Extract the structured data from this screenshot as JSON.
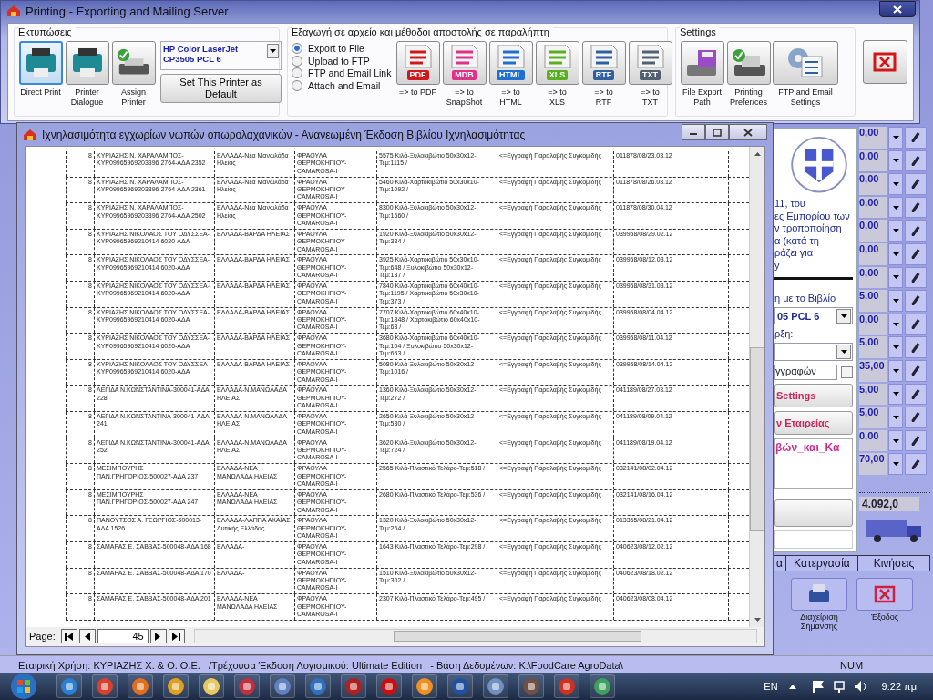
{
  "print_window": {
    "title": "Printing - Exporting and Mailing Server",
    "printers": {
      "label": "Εκτυπώσεις",
      "buttons": [
        {
          "kind": "direct",
          "label": "Direct Print",
          "selected": true
        },
        {
          "kind": "dialogue",
          "label": "Printer Dialogue",
          "selected": false
        },
        {
          "kind": "assign",
          "label": "Assign Printer",
          "selected": false
        }
      ],
      "printer_select": {
        "value": "HP Color LaserJet CP3505 PCL 6"
      },
      "default_button": "Set This Printer as Default"
    },
    "export": {
      "label": "Εξαγωγή σε αρχείο και μέθοδοι αποστολής σε παραλήπτη",
      "methods": [
        {
          "label": "Export to File",
          "selected": true
        },
        {
          "label": "Upload to FTP",
          "selected": false
        },
        {
          "label": "FTP and Email Link",
          "selected": false
        },
        {
          "label": "Attach and Email",
          "selected": false
        }
      ],
      "formats": [
        {
          "kind": "pdf",
          "badge": "PDF",
          "label": "=> to PDF"
        },
        {
          "kind": "mdb",
          "badge": "MDB",
          "label": "=> to\nSnapShot"
        },
        {
          "kind": "html",
          "badge": "HTML",
          "label": "=> to\nHTML"
        },
        {
          "kind": "xls",
          "badge": "XLS",
          "label": "=> to\nXLS"
        },
        {
          "kind": "rtf",
          "badge": "RTF",
          "label": "=> to\nRTF"
        },
        {
          "kind": "txt",
          "badge": "TXT",
          "label": "=> to\nTXT"
        }
      ]
    },
    "settings": {
      "label": "Settings",
      "buttons": [
        {
          "kind": "path",
          "label": "File Export\nPath"
        },
        {
          "kind": "prefs",
          "label": "Printing\nPrefer/ces"
        },
        {
          "kind": "ftp",
          "label": "FTP and Email\nSettings"
        }
      ]
    }
  },
  "report_window": {
    "title": "Ιχνηλασιμότητα εγχωρίων νωπών οπωρολαχανικών - Ανανεωμένη Έκδοση Βιβλίου Ιχνηλασιμότητας",
    "rows": [
      {
        "cells": [
          "8",
          "ΚΥΡΙΑΖΗΣ Ν. ΧΑΡΑΛΑΜΠΟΣ-ΚΥΡ09965969203396 2764-ΑΔΑ 2352",
          "ΕΛΛΑΔΑ-Νέα Μανωλάδα Ηλείας",
          "ΦΡΑΟΥΛΑ ΘΕΡΜΟΚΗΠΙΟΥ-CAMAROSA-I",
          "5575 Κιλά-Ξυλοκιβώτιο 50x30x12-Τεμ:1115 /",
          "<=Εγγραφή Παραλαβής Συγκομιδής",
          "011878/08/23.03.12"
        ]
      },
      {
        "cells": [
          "8",
          "ΚΥΡΙΑΖΗΣ Ν. ΧΑΡΑΛΑΜΠΟΣ-ΚΥΡ09965969203396 2764-ΑΔΑ 2361",
          "ΕΛΛΑΔΑ-Νέα Μανωλάδα Ηλείας",
          "ΦΡΑΟΥΛΑ ΘΕΡΜΟΚΗΠΙΟΥ-CAMAROSA-I",
          "5460 Κιλά-Χαρτοκιβώτιο 50x30x10-Τεμ:1092 /",
          "<=Εγγραφή Παραλαβής Συγκομιδής",
          "011878/08/26.03.12"
        ]
      },
      {
        "cells": [
          "8",
          "ΚΥΡΙΑΖΗΣ Ν. ΧΑΡΑΛΑΜΠΟΣ-ΚΥΡ09965969203396 2764-ΑΔΑ 2502",
          "ΕΛΛΑΔΑ-Νέα Μανωλάδα Ηλείας",
          "ΦΡΑΟΥΛΑ ΘΕΡΜΟΚΗΠΙΟΥ-CAMAROSA-I",
          "8300 Κιλά-Ξυλοκιβώτιο 50x30x12-Τεμ:1660 /",
          "<=Εγγραφή Παραλαβής Συγκομιδής",
          "011878/08/30.04.12"
        ]
      },
      {
        "cells": [
          "8",
          "ΚΥΡΙΑΖΗΣ ΝΙΚΟΛΑΟΣ ΤΟΥ ΟΔΥΣΣΕΑ-ΚΥΡ09965969210414 6020-ΑΔΑ",
          "ΕΛΛΑΔΑ-ΒΑΡΔΑ ΗΛΕΙΑΣ",
          "ΦΡΑΟΥΛΑ ΘΕΡΜΟΚΗΠΙΟΥ-CAMAROSA-I",
          "1920 Κιλά-Ξυλοκιβώτιο 50x30x12-Τεμ:384 /",
          "<=Εγγραφή Παραλαβής Συγκομιδής",
          "039958/08/29.02.12"
        ]
      },
      {
        "cells": [
          "8",
          "ΚΥΡΙΑΖΗΣ ΝΙΚΟΛΑΟΣ ΤΟΥ ΟΔΥΣΣΕΑ-ΚΥΡ09965969210414 6020-ΑΔΑ",
          "ΕΛΛΑΔΑ-ΒΑΡΔΑ ΗΛΕΙΑΣ",
          "ΦΡΑΟΥΛΑ ΘΕΡΜΟΚΗΠΙΟΥ-CAMAROSA-I",
          "3925 Κιλά-Χαρτοκιβώτιο 50x30x10-Τεμ:648 / Ξυλοκιβώτιο 50x30x12-Τεμ:137 /",
          "<=Εγγραφή Παραλαβής Συγκομιδής",
          "039958/08/12.03.12"
        ]
      },
      {
        "cells": [
          "8",
          "ΚΥΡΙΑΖΗΣ ΝΙΚΟΛΑΟΣ ΤΟΥ ΟΔΥΣΣΕΑ-ΚΥΡ09965969210414 6020-ΑΔΑ",
          "ΕΛΛΑΔΑ-ΒΑΡΔΑ ΗΛΕΙΑΣ",
          "ΦΡΑΟΥΛΑ ΘΕΡΜΟΚΗΠΙΟΥ-CAMAROSA-I",
          "7840 Κιλά-Χαρτοκιβώτιο 60x40x10-Τεμ:1195 / Χαρτοκιβώτιο 50x30x10-Τεμ:373 /",
          "<=Εγγραφή Παραλαβής Συγκομιδής",
          "039958/08/31.03.12"
        ]
      },
      {
        "cells": [
          "8",
          "ΚΥΡΙΑΖΗΣ ΝΙΚΟΛΑΟΣ ΤΟΥ ΟΔΥΣΣΕΑ-ΚΥΡ09965969210414 6020-ΑΔΑ",
          "ΕΛΛΑΔΑ-ΒΑΡΔΑ ΗΛΕΙΑΣ",
          "ΦΡΑΟΥΛΑ ΘΕΡΜΟΚΗΠΙΟΥ-CAMAROSA-I",
          "7707 Κιλά-Χαρτοκιβώτιο 60x40x10-Τεμ:1848 / Χαρτοκιβώτιο 60x40x10-Τεμ:63 /",
          "<=Εγγραφή Παραλαβής Συγκομιδής",
          "039958/08/04.04.12"
        ]
      },
      {
        "cells": [
          "8",
          "ΚΥΡΙΑΖΗΣ ΝΙΚΟΛΑΟΣ ΤΟΥ ΟΔΥΣΣΕΑ-ΚΥΡ09965969210414 6020-ΑΔΑ",
          "ΕΛΛΑΔΑ-ΒΑΡΔΑ ΗΛΕΙΑΣ",
          "ΦΡΑΟΥΛΑ ΘΕΡΜΟΚΗΠΙΟΥ-CAMAROSA-I",
          "3680 Κιλά-Χαρτοκιβώτιο 60x40x10-Τεμ:104 / Ξυλοκιβώτιο 50x30x12-Τεμ:653 /",
          "<=Εγγραφή Παραλαβής Συγκομιδής",
          "039958/08/11.04.12"
        ]
      },
      {
        "cells": [
          "8",
          "ΚΥΡΙΑΖΗΣ ΝΙΚΟΛΑΟΣ ΤΟΥ ΟΔΥΣΣΕΑ-ΚΥΡ09965969210414 6020-ΑΔΑ",
          "ΕΛΛΑΔΑ-ΒΑΡΔΑ ΗΛΕΙΑΣ",
          "ΦΡΑΟΥΛΑ ΘΕΡΜΟΚΗΠΙΟΥ-CAMAROSA-I",
          "5080 Κιλά-Ξυλοκιβώτιο 50x30x12-Τεμ:1016 /",
          "<=Εγγραφή Παραλαβής Συγκομιδής",
          "039958/08/14.04.12"
        ]
      },
      {
        "cells": [
          "8",
          "ΛΕΓΙΔΑ Ν.ΚΩΝΣΤΑΝΤΙΝΑ-300041-ΑΔΑ 228",
          "ΕΛΛΑΔΑ-Ν.ΜΑΝΩΛΑΔΑ ΗΛΕΙΑΣ",
          "ΦΡΑΟΥΛΑ ΘΕΡΜΟΚΗΠΙΟΥ-CAMAROSA-I",
          "1360 Κιλά-Ξυλοκιβώτιο 50x30x12-Τεμ:272 /",
          "<=Εγγραφή Παραλαβής Συγκομιδής",
          "041189/08/27.03.12"
        ]
      },
      {
        "cells": [
          "8",
          "ΛΕΓΙΔΑ Ν.ΚΩΝΣΤΑΝΤΙΝΑ-300041-ΑΔΑ 241",
          "ΕΛΛΑΔΑ-Ν.ΜΑΝΩΛΑΔΑ ΗΛΕΙΑΣ",
          "ΦΡΑΟΥΛΑ ΘΕΡΜΟΚΗΠΙΟΥ-CAMAROSA-I",
          "2650 Κιλά-Ξυλοκιβώτιο 50x30x12-Τεμ:530 /",
          "<=Εγγραφή Παραλαβής Συγκομιδής",
          "041189/08/09.04.12"
        ]
      },
      {
        "cells": [
          "8",
          "ΛΕΓΙΔΑ Ν.ΚΩΝΣΤΑΝΤΙΝΑ-300041-ΑΔΑ 252",
          "ΕΛΛΑΔΑ-Ν.ΜΑΝΩΛΑΔΑ ΗΛΕΙΑΣ",
          "ΦΡΑΟΥΛΑ ΘΕΡΜΟΚΗΠΙΟΥ-CAMAROSA-I",
          "3620 Κιλά-Ξυλοκιβώτιο 50x30x12-Τεμ:724 /",
          "<=Εγγραφή Παραλαβής Συγκομιδής",
          "041189/08/19.04.12"
        ]
      },
      {
        "cells": [
          "8",
          "ΜΕΣΙΜΠΟΥΡΗΣ ΠΑΝ.ΓΡΗΓΟΡΙΟΣ-500027-ΑΔΑ 237",
          "ΕΛΛΑΔΑ-ΝΕΑ ΜΑΝΩΛΑΔΑ ΗΛΕΙΑΣ",
          "ΦΡΑΟΥΛΑ ΘΕΡΜΟΚΗΠΙΟΥ-CAMAROSA-I",
          "2565 Κιλά-Πλαστικό Τελάρο-Τεμ:518 /",
          "<=Εγγραφή Παραλαβής Συγκομιδής",
          "032141/08/02.04.12"
        ]
      },
      {
        "cells": [
          "8",
          "ΜΕΣΙΜΠΟΥΡΗΣ ΠΑΝ.ΓΡΗΓΟΡΙΟΣ-500027-ΑΔΑ 247",
          "ΕΛΛΑΔΑ-ΝΕΑ ΜΑΝΩΛΑΔΑ ΗΛΕΙΑΣ",
          "ΦΡΑΟΥΛΑ ΘΕΡΜΟΚΗΠΙΟΥ-CAMAROSA-I",
          "2680 Κιλά-Πλαστικό Τελάρο-Τεμ:536 /",
          "<=Εγγραφή Παραλαβής Συγκομιδής",
          "032141/08/16.04.12"
        ]
      },
      {
        "cells": [
          "8",
          "ΠΑΝΟΥΤΣΟΣ Α. ΓΕΩΡΓΙΟΣ-500013-ΑΔΑ 1526",
          "ΕΛΛΑΔΑ-ΛΑΠΠΑ ΑΧΑΪΑΣ Δυτικής Ελλάδας",
          "ΦΡΑΟΥΛΑ ΘΕΡΜΟΚΗΠΙΟΥ-CAMAROSA-I",
          "1320 Κιλά-Ξυλοκιβώτιο 50x30x12-Τεμ:264 /",
          "<=Εγγραφή Παραλαβής Συγκομιδής",
          "013355/08/21.04.12"
        ]
      },
      {
        "cells": [
          "8",
          "ΣΑΜΑΡΑΣ Ε. ΣΑΒΒΑΣ-500048-ΑΔΑ 168",
          "ΕΛΛΑΔΑ-",
          "ΦΡΑΟΥΛΑ ΘΕΡΜΟΚΗΠΙΟΥ-CAMAROSA-I",
          "1643 Κιλά-Πλαστικό Τελάρο-Τεμ:298 /",
          "<=Εγγραφή Παραλαβής Συγκομιδής",
          "040623/08/12.02.12"
        ]
      },
      {
        "cells": [
          "8",
          "ΣΑΜΑΡΑΣ Ε. ΣΑΒΒΑΣ-500048-ΑΔΑ 170",
          "ΕΛΛΑΔΑ-",
          "ΦΡΑΟΥΛΑ ΘΕΡΜΟΚΗΠΙΟΥ-CAMAROSA-I",
          "1510 Κιλά-Ξυλοκιβώτιο 50x30x12-Τεμ:302 /",
          "<=Εγγραφή Παραλαβής Συγκομιδής",
          "040623/08/18.02.12"
        ]
      },
      {
        "cells": [
          "8",
          "ΣΑΜΑΡΑΣ Ε. ΣΑΒΒΑΣ-500048-ΑΔΑ 201",
          "ΕΛΛΑΔΑ-ΝΕΑ ΜΑΝΩΛΑΔΑ ΗΛΕΙΑΣ",
          "ΦΡΑΟΥΛΑ ΘΕΡΜΟΚΗΠΙΟΥ-CAMAROSA-I",
          "2307 Κιλά-Πλαστικό Τελάρο-Τεμ:495 /",
          "<=Εγγραφή Παραλαβής Συγκομιδής",
          "040623/08/08.04.12"
        ]
      }
    ],
    "pager": {
      "label": "Page:",
      "page": "45"
    }
  },
  "background_app": {
    "panel_lines": [
      "11, του",
      "ες Εμπορίου των",
      "ν τροποποίηση",
      "α (κατά τη",
      "ράζει για",
      "y"
    ],
    "panel_label": "η με το Βιβλίο",
    "printer_value": "05 PCL 6",
    "second_label": "ρξη:",
    "docs_field": "γγραφών",
    "docs_checked": false,
    "buttons": [
      "Settings",
      "ν Εταιρείας"
    ],
    "path_text": "βών_και_Κα",
    "values": [
      "0,00",
      "0,00",
      "0,00",
      "0,00",
      "0,00",
      "0,00",
      "0,00",
      "5,00",
      "0,00",
      "5,00",
      "35,00",
      "5,00",
      "5,00",
      "0,00",
      "70,00"
    ],
    "total": "4.092,0",
    "headers": [
      "α",
      "Κατεργασία",
      "Κινήσεις"
    ],
    "actions": [
      {
        "kind": "printer",
        "label": "Διαχείριση Σήμανσης"
      },
      {
        "kind": "exit",
        "label": "Έξοδος"
      }
    ]
  },
  "status_bar": {
    "text": "Εταιρική Χρήση: ΚΥΡΙΑΖΗΣ Χ. & Ο. Ο.Ε.   /Τρέχουσα Έκδοση Λογισμικού: Ultimate Edition   - Βάση Δεδομένων: K:\\FoodCare AgroData\\",
    "num": "NUM"
  },
  "taskbar": {
    "language": "EN",
    "clock": "9:22 πμ"
  }
}
